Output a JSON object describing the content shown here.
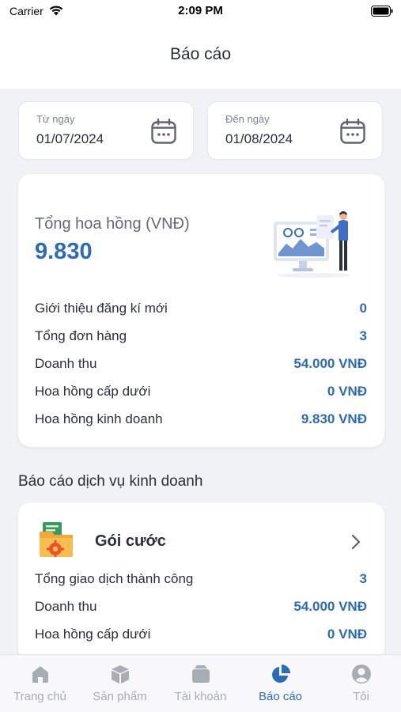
{
  "status_bar": {
    "carrier": "Carrier",
    "time": "2:09 PM"
  },
  "header": {
    "title": "Báo cáo"
  },
  "date_range": {
    "from_label": "Từ ngày",
    "from_value": "01/07/2024",
    "to_label": "Đến ngày",
    "to_value": "01/08/2024"
  },
  "summary": {
    "label": "Tổng hoa hồng (VNĐ)",
    "value": "9.830",
    "stats": [
      {
        "label": "Giới thiệu đăng kí mới",
        "value": "0"
      },
      {
        "label": "Tổng đơn hàng",
        "value": "3"
      },
      {
        "label": "Doanh thu",
        "value": "54.000 VNĐ"
      },
      {
        "label": "Hoa hồng cấp dưới",
        "value": "0 VNĐ"
      },
      {
        "label": "Hoa hồng kinh doanh",
        "value": "9.830 VNĐ"
      }
    ]
  },
  "services_section": {
    "title": "Báo cáo dịch vụ kinh doanh",
    "items": [
      {
        "name": "Gói cước",
        "stats": [
          {
            "label": "Tổng giao dịch thành công",
            "value": "3"
          },
          {
            "label": "Doanh thu",
            "value": "54.000 VNĐ"
          },
          {
            "label": "Hoa hồng cấp dưới",
            "value": "0 VNĐ"
          }
        ]
      }
    ]
  },
  "tabs": [
    {
      "label": "Trang chủ",
      "icon": "home-icon"
    },
    {
      "label": "Sản phẩm",
      "icon": "box-icon"
    },
    {
      "label": "Tài khoản",
      "icon": "wallet-icon"
    },
    {
      "label": "Báo cáo",
      "icon": "pie-chart-icon",
      "active": true
    },
    {
      "label": "Tôi",
      "icon": "user-icon"
    }
  ],
  "colors": {
    "accent": "#2d6cb3",
    "tab_inactive": "#a8adb4",
    "background": "#f1f2f5"
  }
}
